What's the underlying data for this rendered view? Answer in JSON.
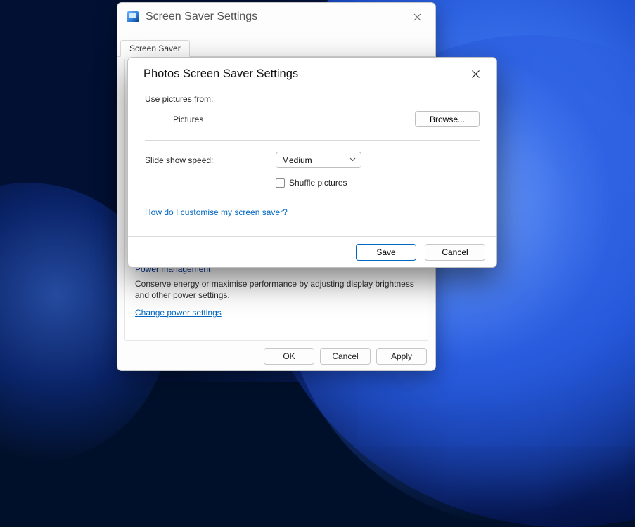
{
  "back_window": {
    "title": "Screen Saver Settings",
    "tab": "Screen Saver",
    "power_heading": "Power management",
    "power_text": "Conserve energy or maximise performance by adjusting display brightness and other power settings.",
    "power_link": "Change power settings",
    "buttons": {
      "ok": "OK",
      "cancel": "Cancel",
      "apply": "Apply"
    }
  },
  "front_window": {
    "title": "Photos Screen Saver Settings",
    "use_from_label": "Use pictures from:",
    "folder_value": "Pictures",
    "browse": "Browse...",
    "speed_label": "Slide show speed:",
    "speed_value": "Medium",
    "shuffle_label": "Shuffle pictures",
    "shuffle_checked": false,
    "help_link": "How do I customise my screen saver?",
    "save": "Save",
    "cancel": "Cancel"
  }
}
